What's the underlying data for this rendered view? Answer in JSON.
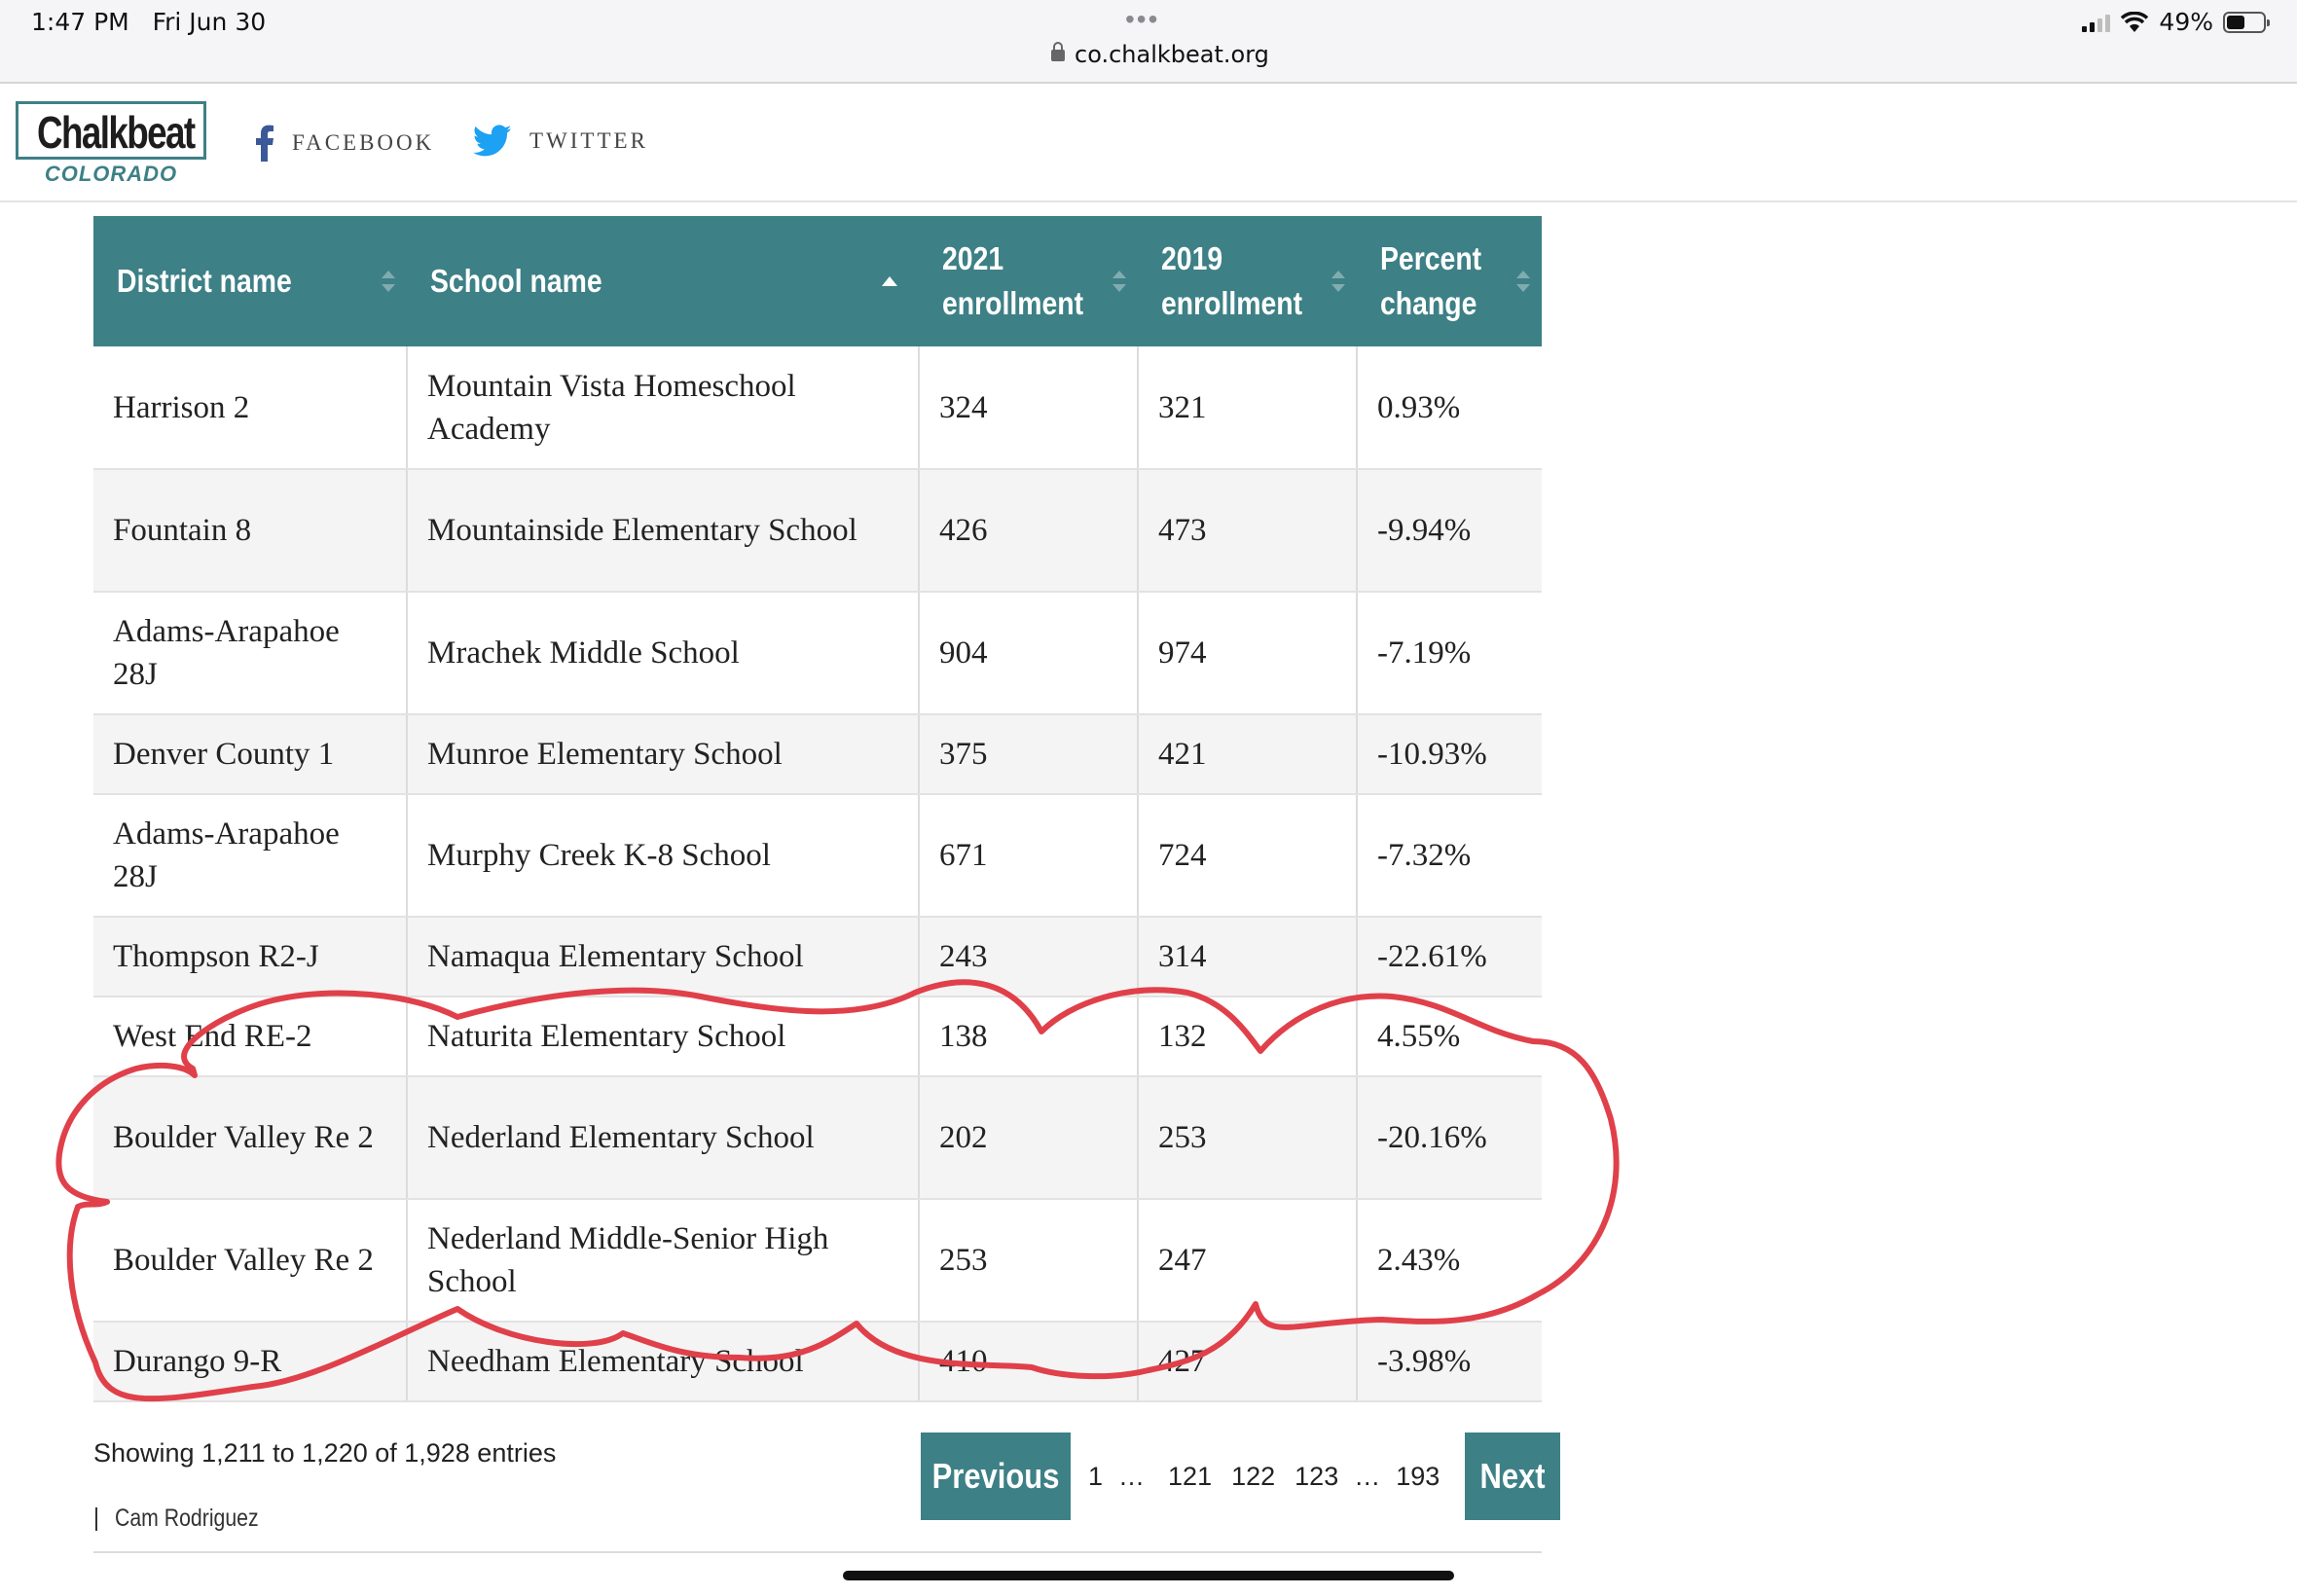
{
  "status_bar": {
    "time": "1:47 PM",
    "date": "Fri Jun 30",
    "url": "co.chalkbeat.org",
    "battery": "49%"
  },
  "header": {
    "logo": "Chalkbeat",
    "logo_sub": "COLORADO",
    "facebook": "FACEBOOK",
    "twitter": "TWITTER"
  },
  "table": {
    "columns": [
      "District name",
      "School name",
      "2021 enrollment",
      "2019 enrollment",
      "Percent change"
    ],
    "columns_lines": [
      [
        "District name"
      ],
      [
        "School name"
      ],
      [
        "2021",
        "enrollment"
      ],
      [
        "2019",
        "enrollment"
      ],
      [
        "Percent",
        "change"
      ]
    ],
    "rows": [
      [
        "Harrison 2",
        "Mountain Vista Homeschool Academy",
        "324",
        "321",
        "0.93%"
      ],
      [
        "Fountain 8",
        "Mountainside Elementary School",
        "426",
        "473",
        "-9.94%"
      ],
      [
        "Adams-Arapahoe 28J",
        "Mrachek Middle School",
        "904",
        "974",
        "-7.19%"
      ],
      [
        "Denver County 1",
        "Munroe Elementary School",
        "375",
        "421",
        "-10.93%"
      ],
      [
        "Adams-Arapahoe 28J",
        "Murphy Creek K-8 School",
        "671",
        "724",
        "-7.32%"
      ],
      [
        "Thompson R2-J",
        "Namaqua Elementary School",
        "243",
        "314",
        "-22.61%"
      ],
      [
        "West End RE-2",
        "Naturita Elementary School",
        "138",
        "132",
        "4.55%"
      ],
      [
        "Boulder Valley Re 2",
        "Nederland Elementary School",
        "202",
        "253",
        "-20.16%"
      ],
      [
        "Boulder Valley Re 2",
        "Nederland Middle-Senior High School",
        "253",
        "247",
        "2.43%"
      ],
      [
        "Durango 9-R",
        "Needham Elementary School",
        "410",
        "427",
        "-3.98%"
      ]
    ]
  },
  "footer": {
    "info": "Showing 1,211 to 1,220 of 1,928 entries",
    "previous": "Previous",
    "next": "Next",
    "pages": [
      "1",
      "…",
      "121",
      "122",
      "123",
      "…",
      "193"
    ],
    "credit": "Cam Rodriguez"
  },
  "colors": {
    "teal": "#3d8086",
    "annotation_red": "#e0404a"
  },
  "icons": {
    "facebook": "facebook-icon",
    "twitter": "twitter-icon",
    "lock": "lock-icon",
    "wifi": "wifi-icon",
    "battery": "battery-icon"
  }
}
